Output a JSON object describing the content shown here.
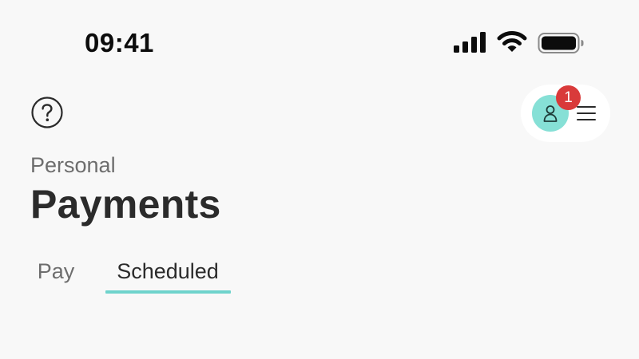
{
  "status_bar": {
    "time": "09:41",
    "icons": [
      "cellular-signal-icon",
      "wifi-icon",
      "battery-icon"
    ]
  },
  "header": {
    "help_icon": "question-circle-icon",
    "avatar_icon": "person-icon",
    "notification_count": "1",
    "menu_icon": "hamburger-menu-icon"
  },
  "page": {
    "subtitle": "Personal",
    "title": "Payments"
  },
  "tabs": [
    {
      "label": "Pay",
      "active": false
    },
    {
      "label": "Scheduled",
      "active": true
    }
  ],
  "colors": {
    "background": "#f8f8f8",
    "accent": "#6fd3cc",
    "avatar": "#86e0d6",
    "badge": "#d93a3a",
    "text_primary": "#2b2b2b",
    "text_secondary": "#6d6d6d"
  }
}
